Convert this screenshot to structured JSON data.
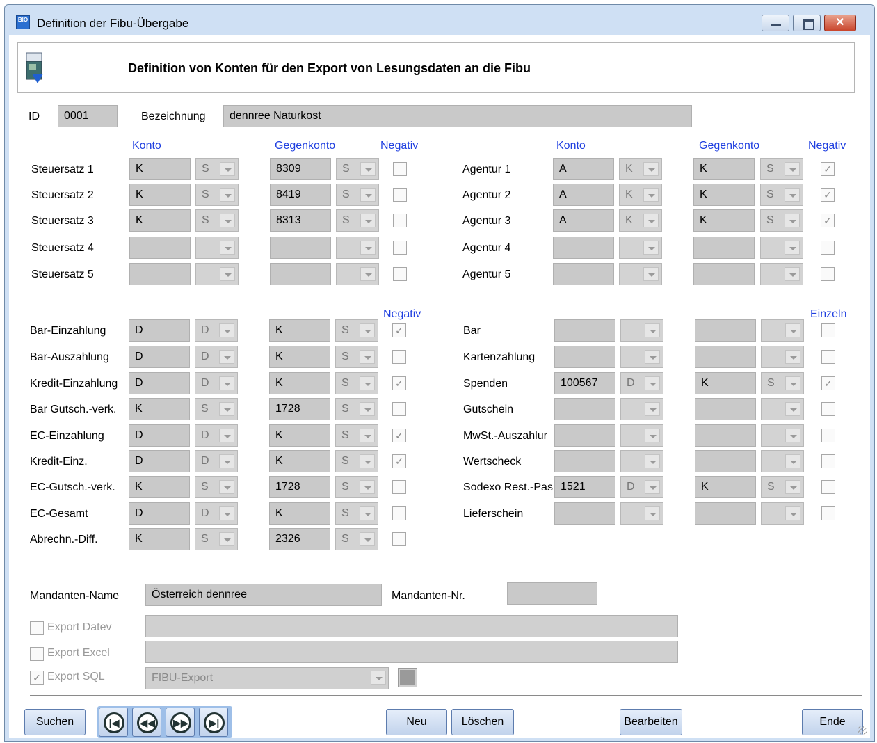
{
  "window": {
    "title": "Definition der Fibu-Übergabe",
    "app_icon_text": "BIO",
    "close_glyph": "✕"
  },
  "header": {
    "title": "Definition von Konten für den Export von Lesungsdaten an die Fibu"
  },
  "id_field": {
    "label": "ID",
    "value": "0001"
  },
  "bezeichnung": {
    "label": "Bezeichnung",
    "value": "dennree Naturkost"
  },
  "tax_section": {
    "left_headers": {
      "konto": "Konto",
      "gegenkonto": "Gegenkonto",
      "negativ": "Negativ"
    },
    "right_headers": {
      "konto": "Konto",
      "gegenkonto": "Gegenkonto",
      "negativ": "Negativ"
    },
    "left_rows": [
      {
        "label": "Steuersatz 1",
        "konto": "K",
        "konto_type": "S",
        "gegenkonto": "8309",
        "gegen_type": "S",
        "negativ": false
      },
      {
        "label": "Steuersatz 2",
        "konto": "K",
        "konto_type": "S",
        "gegenkonto": "8419",
        "gegen_type": "S",
        "negativ": false
      },
      {
        "label": "Steuersatz 3",
        "konto": "K",
        "konto_type": "S",
        "gegenkonto": "8313",
        "gegen_type": "S",
        "negativ": false
      },
      {
        "label": "Steuersatz 4",
        "konto": "",
        "konto_type": "",
        "gegenkonto": "",
        "gegen_type": "",
        "negativ": false
      },
      {
        "label": "Steuersatz 5",
        "konto": "",
        "konto_type": "",
        "gegenkonto": "",
        "gegen_type": "",
        "negativ": false
      }
    ],
    "right_rows": [
      {
        "label": "Agentur 1",
        "konto": "A",
        "konto_type": "K",
        "gegenkonto": "K",
        "gegen_type": "S",
        "negativ": true
      },
      {
        "label": "Agentur 2",
        "konto": "A",
        "konto_type": "K",
        "gegenkonto": "K",
        "gegen_type": "S",
        "negativ": true
      },
      {
        "label": "Agentur 3",
        "konto": "A",
        "konto_type": "K",
        "gegenkonto": "K",
        "gegen_type": "S",
        "negativ": true
      },
      {
        "label": "Agentur 4",
        "konto": "",
        "konto_type": "",
        "gegenkonto": "",
        "gegen_type": "",
        "negativ": false
      },
      {
        "label": "Agentur 5",
        "konto": "",
        "konto_type": "",
        "gegenkonto": "",
        "gegen_type": "",
        "negativ": false
      }
    ]
  },
  "payment_section": {
    "left_header": "Negativ",
    "right_header": "Einzeln",
    "left_rows": [
      {
        "label": "Bar-Einzahlung",
        "konto": "D",
        "konto_type": "D",
        "gegenkonto": "K",
        "gegen_type": "S",
        "checked": true
      },
      {
        "label": "Bar-Auszahlung",
        "konto": "D",
        "konto_type": "D",
        "gegenkonto": "K",
        "gegen_type": "S",
        "checked": false
      },
      {
        "label": "Kredit-Einzahlung",
        "konto": "D",
        "konto_type": "D",
        "gegenkonto": "K",
        "gegen_type": "S",
        "checked": true
      },
      {
        "label": "Bar Gutsch.-verk.",
        "konto": "K",
        "konto_type": "S",
        "gegenkonto": "1728",
        "gegen_type": "S",
        "checked": false
      },
      {
        "label": "EC-Einzahlung",
        "konto": "D",
        "konto_type": "D",
        "gegenkonto": "K",
        "gegen_type": "S",
        "checked": true
      },
      {
        "label": "Kredit-Einz.",
        "konto": "D",
        "konto_type": "D",
        "gegenkonto": "K",
        "gegen_type": "S",
        "checked": true
      },
      {
        "label": "EC-Gutsch.-verk.",
        "konto": "K",
        "konto_type": "S",
        "gegenkonto": "1728",
        "gegen_type": "S",
        "checked": false
      },
      {
        "label": "EC-Gesamt",
        "konto": "D",
        "konto_type": "D",
        "gegenkonto": "K",
        "gegen_type": "S",
        "checked": false
      },
      {
        "label": "Abrechn.-Diff.",
        "konto": "K",
        "konto_type": "S",
        "gegenkonto": "2326",
        "gegen_type": "S",
        "checked": false
      }
    ],
    "right_rows": [
      {
        "label": "Bar",
        "konto": "",
        "konto_type": "",
        "gegenkonto": "",
        "gegen_type": "",
        "checked": false
      },
      {
        "label": "Kartenzahlung",
        "konto": "",
        "konto_type": "",
        "gegenkonto": "",
        "gegen_type": "",
        "checked": false
      },
      {
        "label": "Spenden",
        "konto": "100567",
        "konto_type": "D",
        "gegenkonto": "K",
        "gegen_type": "S",
        "checked": true
      },
      {
        "label": "Gutschein",
        "konto": "",
        "konto_type": "",
        "gegenkonto": "",
        "gegen_type": "",
        "checked": false
      },
      {
        "label": "MwSt.-Auszahlur",
        "konto": "",
        "konto_type": "",
        "gegenkonto": "",
        "gegen_type": "",
        "checked": false
      },
      {
        "label": "Wertscheck",
        "konto": "",
        "konto_type": "",
        "gegenkonto": "",
        "gegen_type": "",
        "checked": false
      },
      {
        "label": "Sodexo Rest.-Pas",
        "konto": "1521",
        "konto_type": "D",
        "gegenkonto": "K",
        "gegen_type": "S",
        "checked": false
      },
      {
        "label": "Lieferschein",
        "konto": "",
        "konto_type": "",
        "gegenkonto": "",
        "gegen_type": "",
        "checked": false
      }
    ]
  },
  "mandant": {
    "name_label": "Mandanten-Name",
    "name_value": "Österreich dennree",
    "nr_label": "Mandanten-Nr.",
    "nr_value": ""
  },
  "export": {
    "datev": {
      "label": "Export Datev",
      "checked": false,
      "value": ""
    },
    "excel": {
      "label": "Export Excel",
      "checked": false,
      "value": ""
    },
    "sql": {
      "label": "Export SQL",
      "checked": true,
      "value": "FIBU-Export"
    }
  },
  "buttons": {
    "suchen": "Suchen",
    "neu": "Neu",
    "loeschen": "Löschen",
    "bearbeiten": "Bearbeiten",
    "ende": "Ende"
  },
  "navigation": [
    {
      "name": "first-record-icon",
      "glyph": "|◀"
    },
    {
      "name": "previous-record-icon",
      "glyph": "◀◀"
    },
    {
      "name": "next-record-icon",
      "glyph": "▶▶"
    },
    {
      "name": "last-record-icon",
      "glyph": "▶|"
    }
  ],
  "check_glyph": "✓"
}
